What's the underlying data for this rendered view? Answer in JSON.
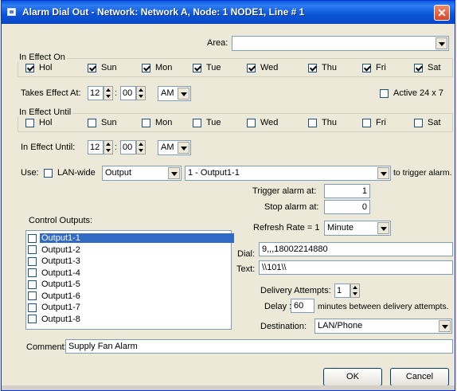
{
  "window": {
    "title": "Alarm Dial Out - Network: Network A,  Node: 1 NODE1, Line # 1",
    "close_glyph": "✕"
  },
  "area": {
    "label": "Area:",
    "value": ""
  },
  "in_effect_on": {
    "title": "In Effect On",
    "days": [
      {
        "label": "Hol",
        "checked": true
      },
      {
        "label": "Sun",
        "checked": true
      },
      {
        "label": "Mon",
        "checked": true
      },
      {
        "label": "Tue",
        "checked": true
      },
      {
        "label": "Wed",
        "checked": true
      },
      {
        "label": "Thu",
        "checked": true
      },
      {
        "label": "Fri",
        "checked": true
      },
      {
        "label": "Sat",
        "checked": true
      }
    ]
  },
  "takes_effect": {
    "label": "Takes Effect At:",
    "hour": "12",
    "sep": ":",
    "minute": "00",
    "ampm": "AM"
  },
  "active24x7": {
    "label": "Active 24 x 7",
    "checked": false
  },
  "in_effect_until_group": {
    "title": "In Effect Until",
    "days": [
      {
        "label": "Hol",
        "checked": false
      },
      {
        "label": "Sun",
        "checked": false
      },
      {
        "label": "Mon",
        "checked": false
      },
      {
        "label": "Tue",
        "checked": false
      },
      {
        "label": "Wed",
        "checked": false
      },
      {
        "label": "Thu",
        "checked": false
      },
      {
        "label": "Fri",
        "checked": false
      },
      {
        "label": "Sat",
        "checked": false
      }
    ]
  },
  "in_effect_until_time": {
    "label": "In Effect Until:",
    "hour": "12",
    "sep": ":",
    "minute": "00",
    "ampm": "AM"
  },
  "use": {
    "label": "Use:",
    "lan_label": "LAN-wide",
    "lan_checked": false,
    "type": "Output",
    "point": "1 - Output1-1",
    "suffix": "to trigger alarm."
  },
  "trigger": {
    "label": "Trigger alarm at:",
    "value": "1"
  },
  "stop": {
    "label": "Stop alarm at:",
    "value": "0"
  },
  "control_outputs": {
    "label": "Control Outputs:",
    "items": [
      {
        "label": "Output1-1",
        "checked": false,
        "selected": true
      },
      {
        "label": "Output1-2",
        "checked": false,
        "selected": false
      },
      {
        "label": "Output1-3",
        "checked": false,
        "selected": false
      },
      {
        "label": "Output1-4",
        "checked": false,
        "selected": false
      },
      {
        "label": "Output1-5",
        "checked": false,
        "selected": false
      },
      {
        "label": "Output1-6",
        "checked": false,
        "selected": false
      },
      {
        "label": "Output1-7",
        "checked": false,
        "selected": false
      },
      {
        "label": "Output1-8",
        "checked": false,
        "selected": false
      }
    ]
  },
  "refresh": {
    "label": "Refresh Rate = 1",
    "unit": "Minute"
  },
  "dial": {
    "label": "Dial:",
    "value": "9,,,18002214880"
  },
  "text": {
    "label": "Text:",
    "value": "\\\\101\\\\"
  },
  "delivery": {
    "label": "Delivery Attempts:",
    "value": "1"
  },
  "delay": {
    "label": "Delay :",
    "value": "60",
    "suffix": "minutes between delivery attempts."
  },
  "destination": {
    "label": "Destination:",
    "value": "LAN/Phone"
  },
  "comment": {
    "label": "Comment:",
    "value": "Supply Fan Alarm"
  },
  "buttons": {
    "ok": "OK",
    "cancel": "Cancel"
  }
}
